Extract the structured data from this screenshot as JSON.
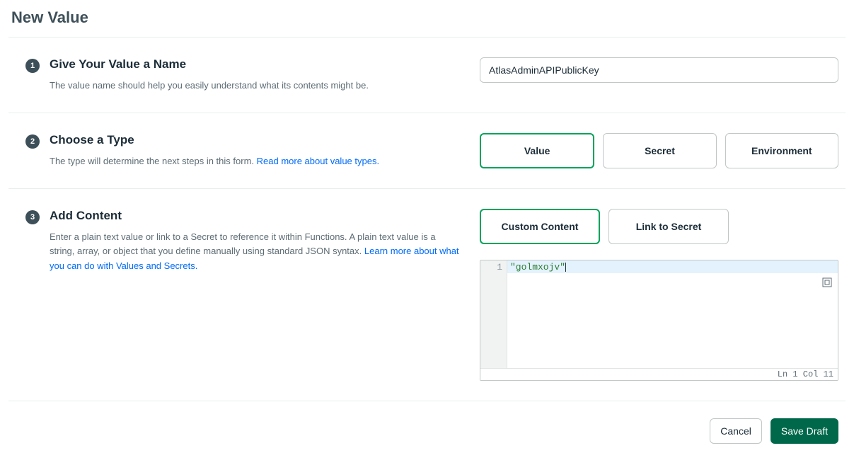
{
  "page_title": "New Value",
  "steps": {
    "s1": {
      "number": "1",
      "title": "Give Your Value a Name",
      "desc": "The value name should help you easily understand what its contents might be.",
      "input_value": "AtlasAdminAPIPublicKey"
    },
    "s2": {
      "number": "2",
      "title": "Choose a Type",
      "desc_prefix": "The type will determine the next steps in this form. ",
      "desc_link": "Read more about value types.",
      "options": {
        "value": "Value",
        "secret": "Secret",
        "environment": "Environment"
      }
    },
    "s3": {
      "number": "3",
      "title": "Add Content",
      "desc_prefix": "Enter a plain text value or link to a Secret to reference it within Functions. A plain text value is a string, array, or object that you define manually using standard JSON syntax. ",
      "desc_link": "Learn more about what you can do with Values and Secrets.",
      "options": {
        "custom": "Custom Content",
        "link_secret": "Link to Secret"
      },
      "editor": {
        "line_number": "1",
        "content": "\"golmxojv\"",
        "status": "Ln 1 Col 11"
      }
    }
  },
  "footer": {
    "cancel": "Cancel",
    "save": "Save Draft"
  }
}
